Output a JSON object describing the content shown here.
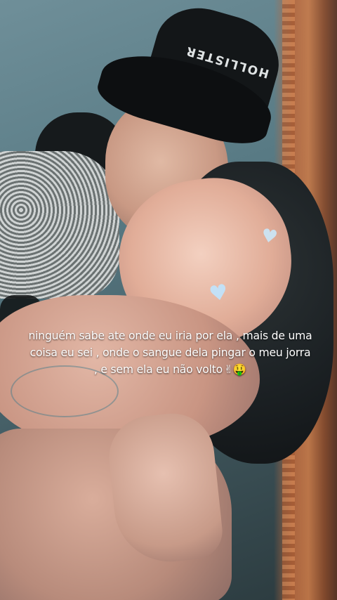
{
  "photo": {
    "hat_text": "HOLLISTER"
  },
  "caption": {
    "text": "ninguém sabe ate onde eu iria por ela , mais de uma coisa eu sei , onde o sangue dela pingar o meu jorra , e sem ela eu não volto",
    "emojis": "✌🤑"
  },
  "stickers": {
    "heart_symbol": "♥"
  }
}
